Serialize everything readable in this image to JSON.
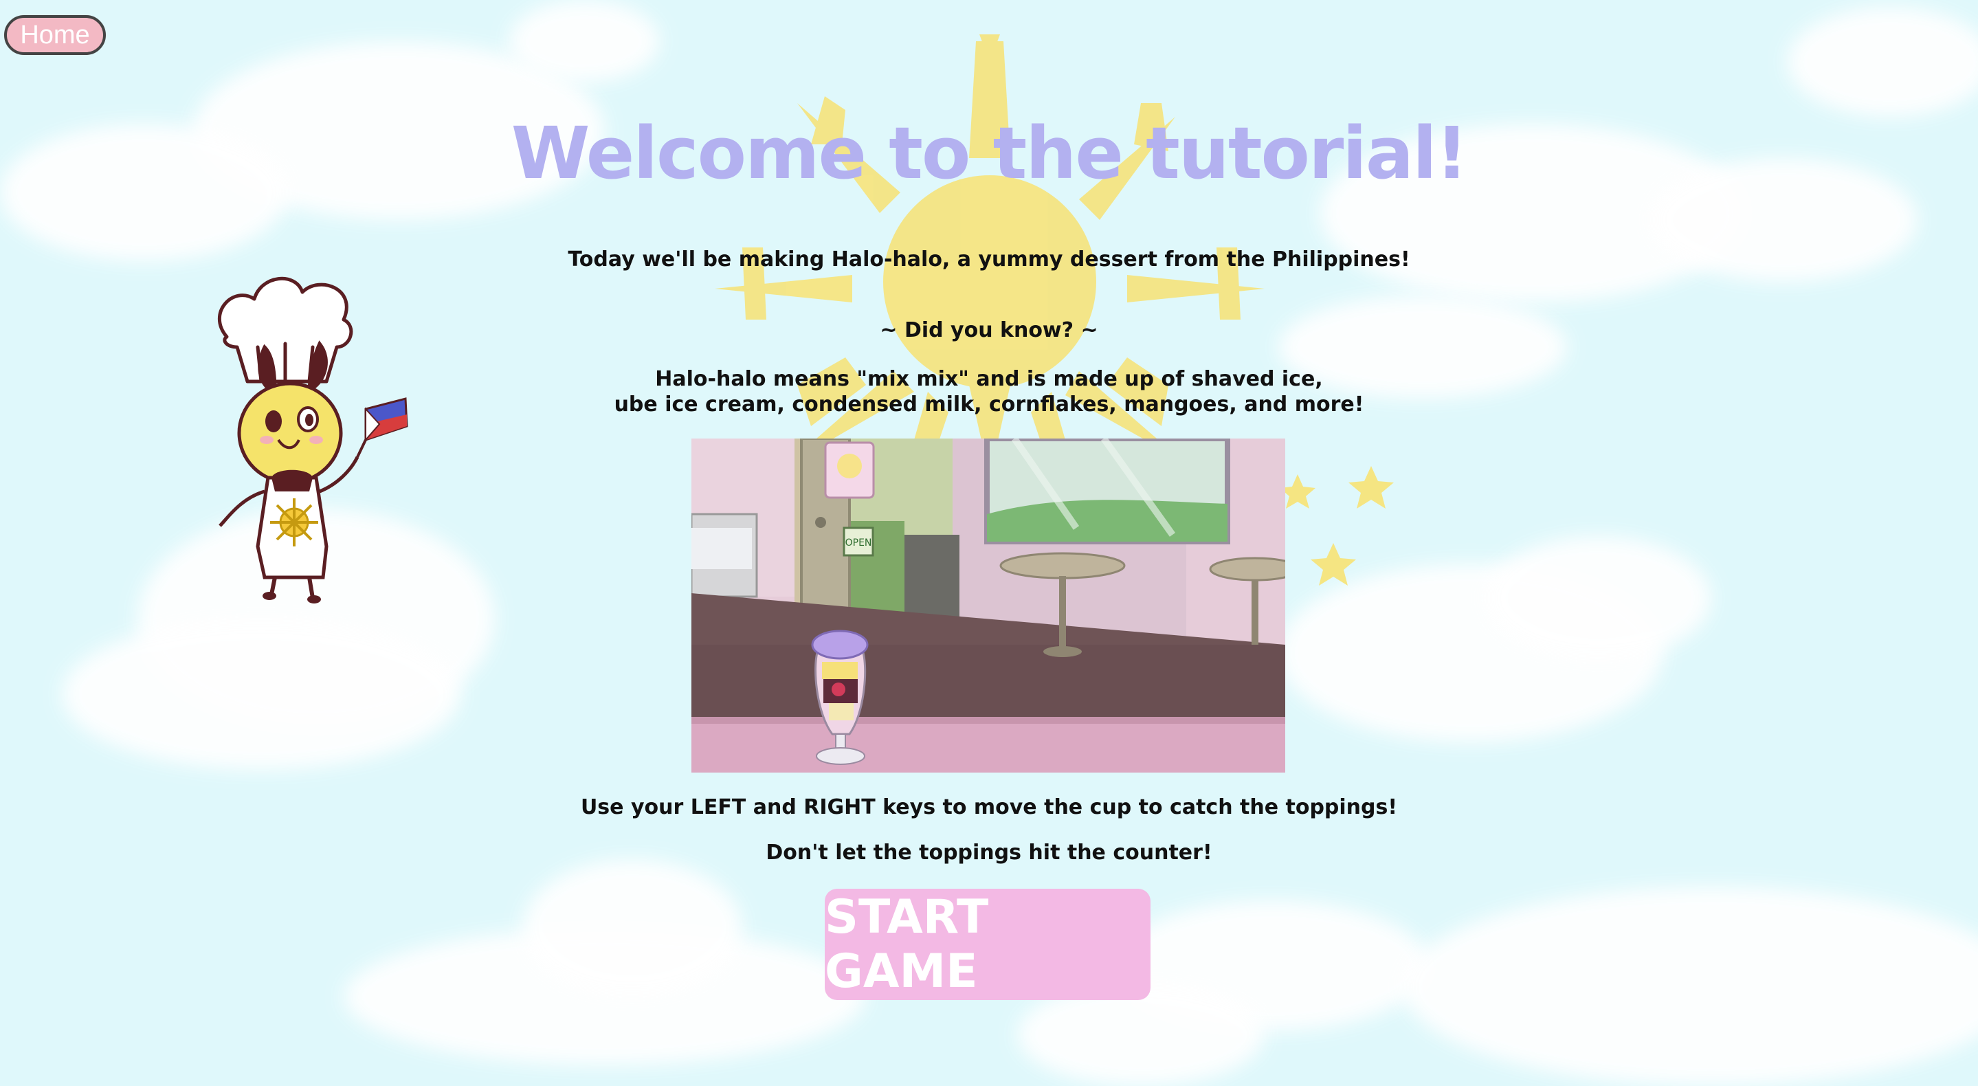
{
  "nav": {
    "home_label": "Home"
  },
  "tutorial": {
    "title": "Welcome to the tutorial!",
    "intro": "Today we'll be making Halo-halo, a yummy dessert from the Philippines!",
    "fact_heading": "~ Did you know? ~",
    "fact_line1": "Halo-halo means \"mix mix\" and is made up of shaved ice,",
    "fact_line2": "ube ice cream, condensed milk, cornflakes, mangoes, and more!",
    "instruction1": "Use your LEFT and RIGHT keys to move the cup to catch the toppings!",
    "instruction2": "Don't let the toppings hit the counter!",
    "start_label": "START GAME"
  },
  "preview": {
    "sign_text": "OPEN"
  },
  "colors": {
    "sky": "#dff8fb",
    "title": "#b3b1f0",
    "home_button": "#f3b9c4",
    "start_button": "#f3b9e4",
    "sun": "#f5e582"
  }
}
